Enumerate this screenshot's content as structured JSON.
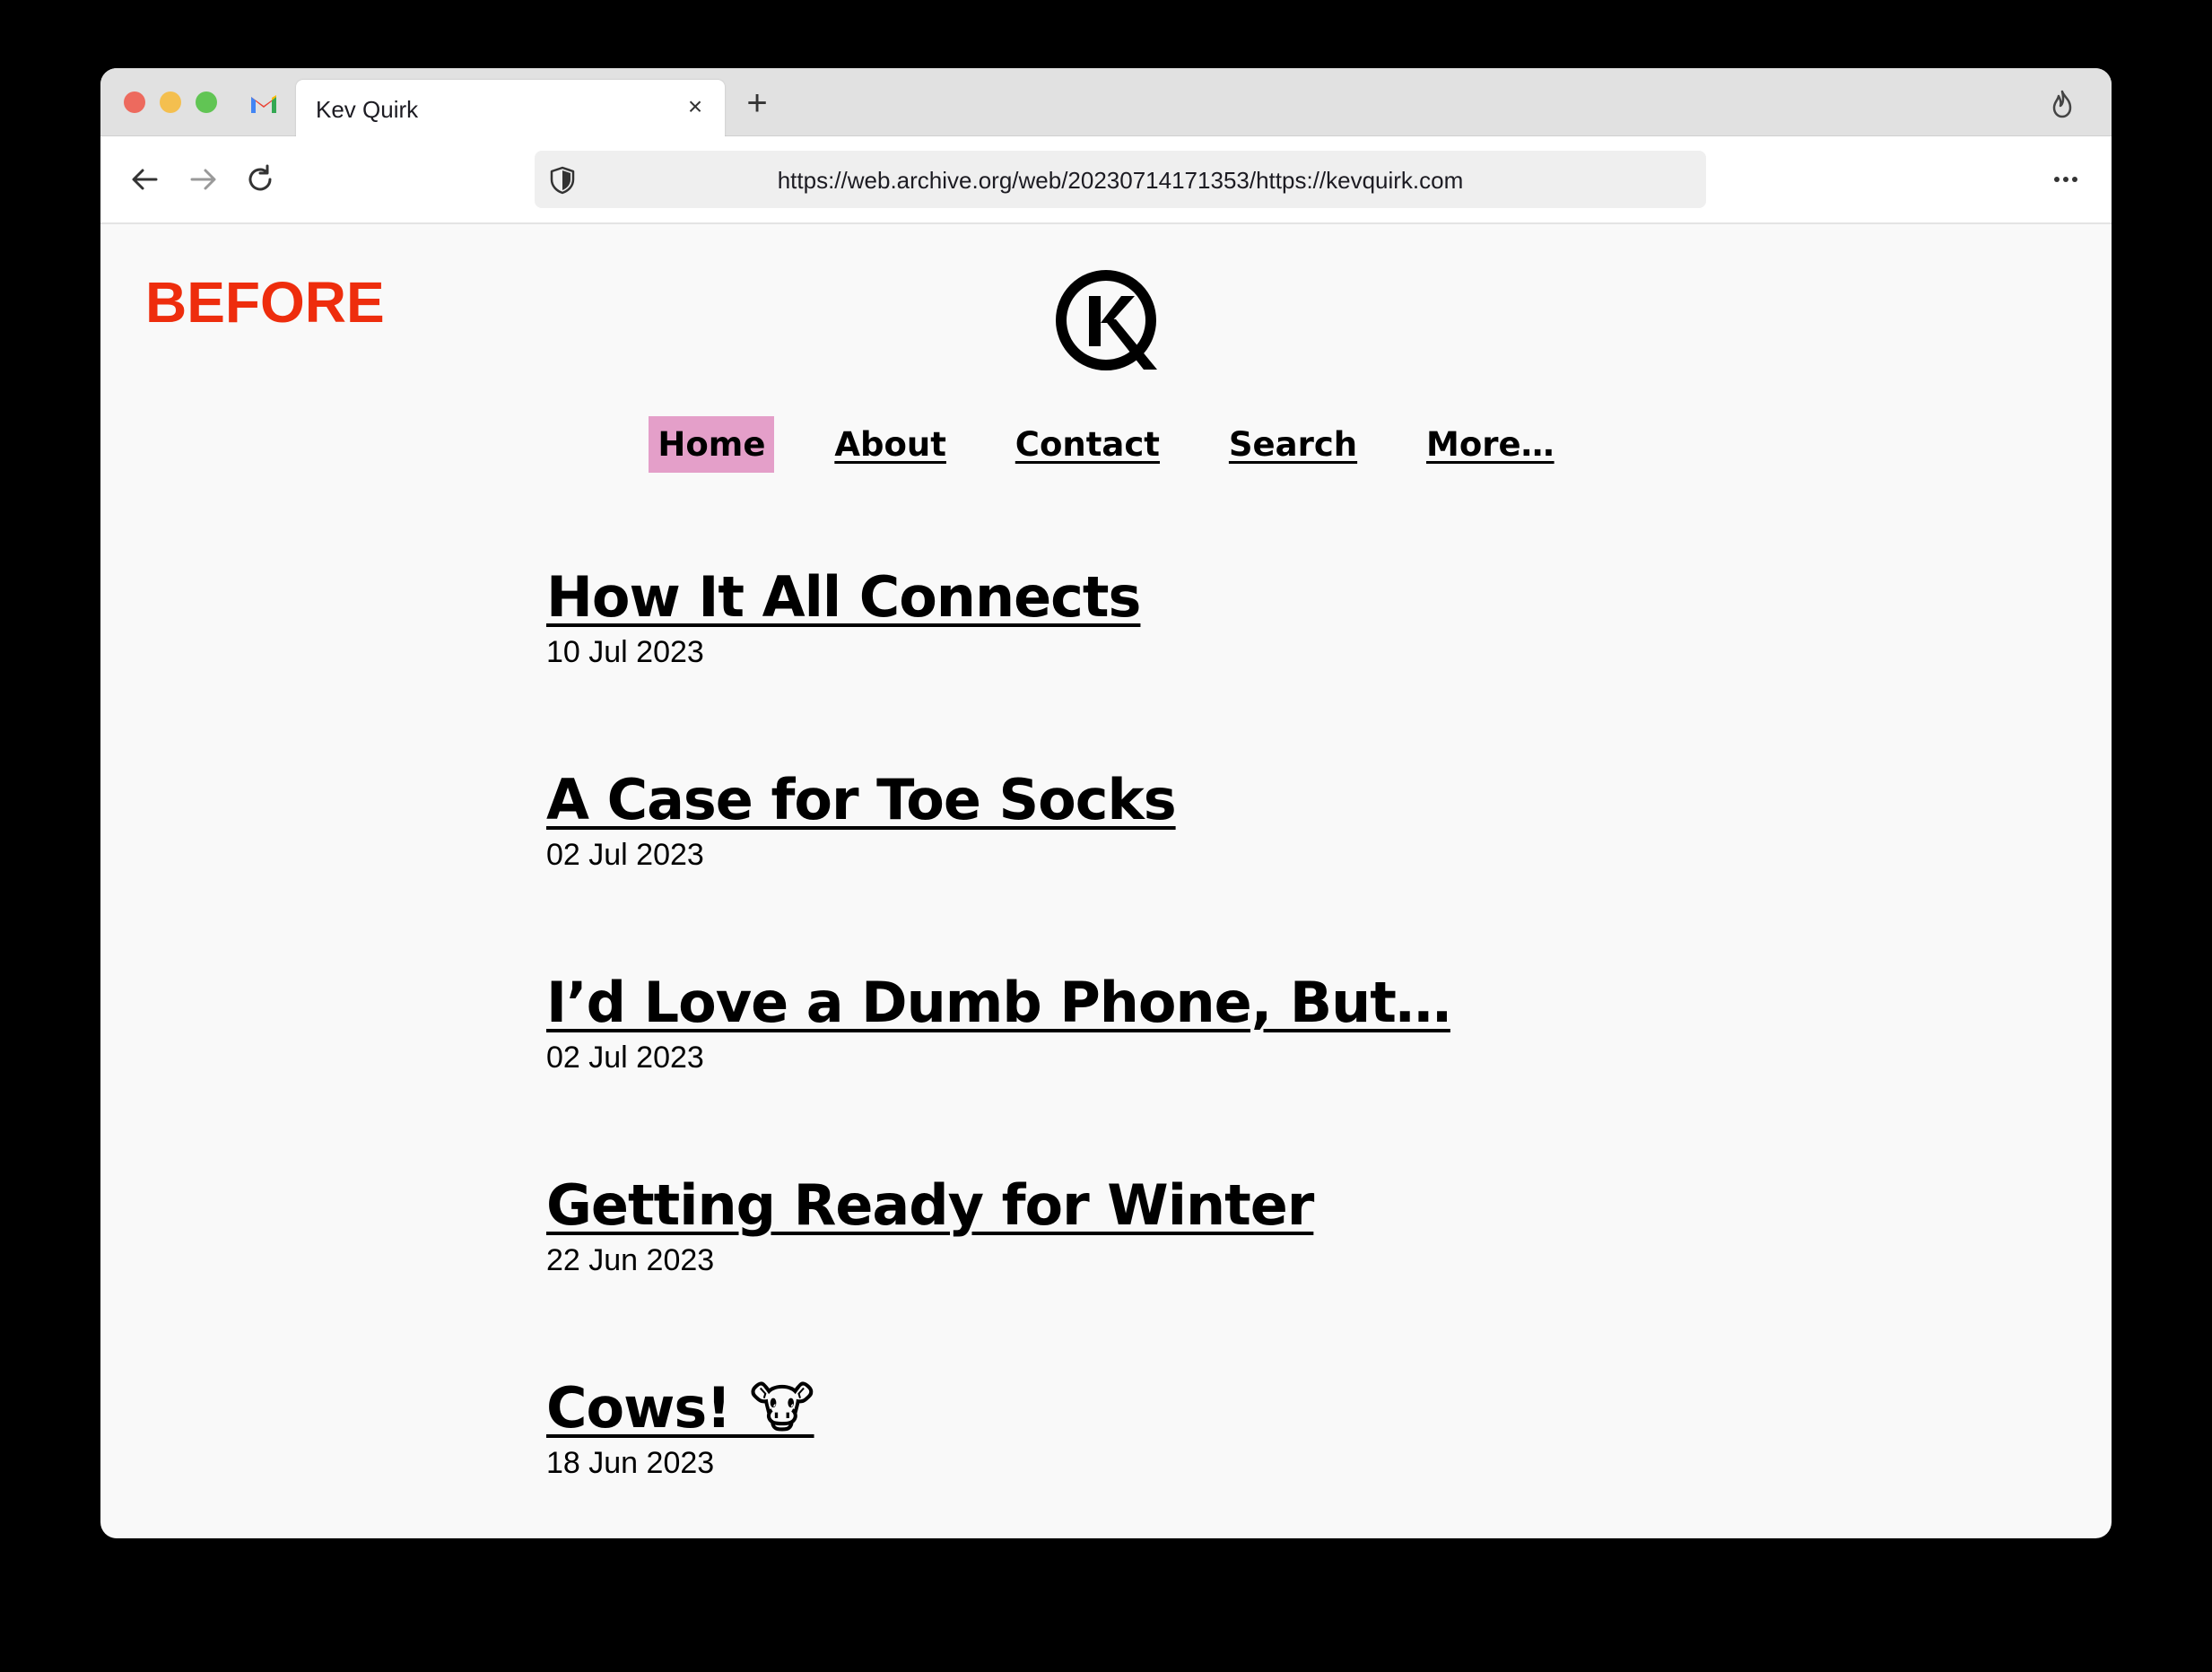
{
  "browser": {
    "tab_title": "Kev Quirk",
    "tab_close": "×",
    "new_tab": "+",
    "url": "https://web.archive.org/web/20230714171353/https://kevquirk.com"
  },
  "overlay": {
    "label": "BEFORE",
    "color": "#ee2d0d"
  },
  "nav": {
    "active_color": "#e49fc9",
    "items": [
      {
        "label": "Home",
        "active": true
      },
      {
        "label": "About"
      },
      {
        "label": "Contact"
      },
      {
        "label": "Search"
      },
      {
        "label": "More…"
      }
    ]
  },
  "posts": [
    {
      "title": "How It All Connects",
      "date": "10 Jul 2023"
    },
    {
      "title": "A Case for Toe Socks",
      "date": "02 Jul 2023"
    },
    {
      "title": "I’d Love a Dumb Phone, But…",
      "date": "02 Jul 2023"
    },
    {
      "title": "Getting Ready for Winter",
      "date": "22 Jun 2023"
    },
    {
      "title": "Cows! 🐮",
      "date": "18 Jun 2023"
    }
  ]
}
